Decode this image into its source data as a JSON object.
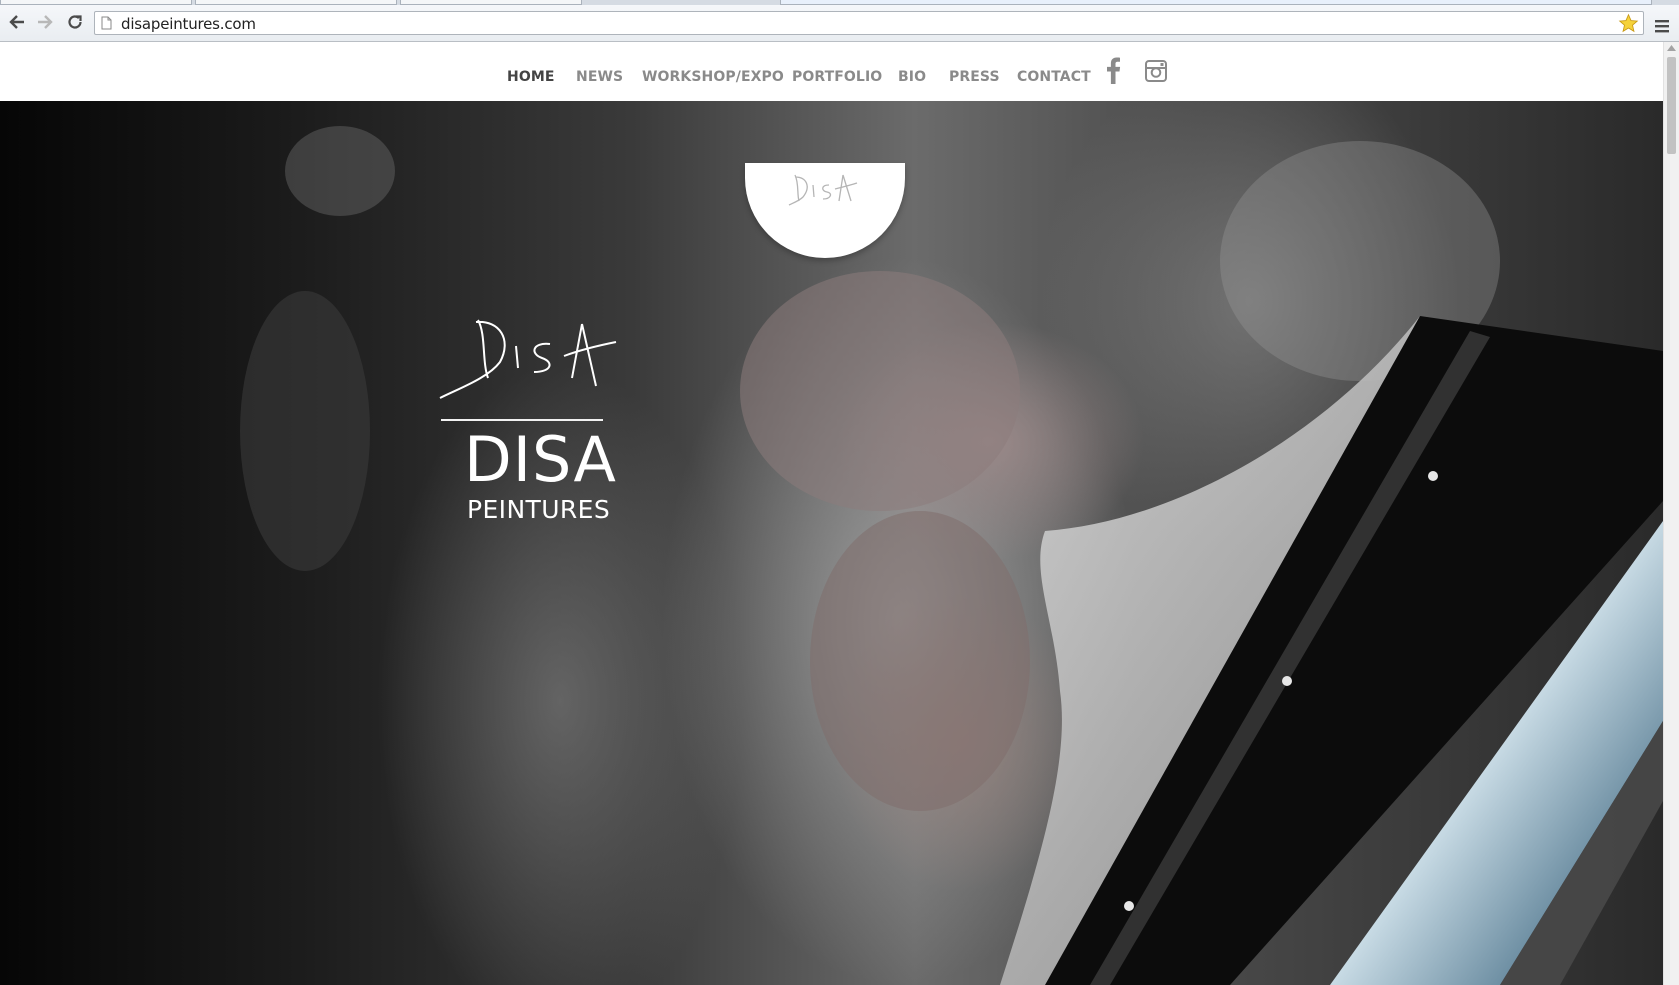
{
  "browser": {
    "url": "disapeintures.com",
    "icons": {
      "back": "back-arrow-icon",
      "forward": "forward-arrow-icon",
      "reload": "reload-icon",
      "bookmark": "star-icon",
      "menu": "hamburger-menu-icon"
    }
  },
  "nav": {
    "items": [
      {
        "label": "HOME",
        "active": true
      },
      {
        "label": "NEWS",
        "active": false
      },
      {
        "label": "WORKSHOP/EXPO",
        "active": false
      },
      {
        "label": "PORTFOLIO",
        "active": false
      },
      {
        "label": "BIO",
        "active": false
      },
      {
        "label": "PRESS",
        "active": false
      },
      {
        "label": "CONTACT",
        "active": false
      }
    ],
    "social": [
      "facebook-icon",
      "instagram-icon"
    ],
    "colors": {
      "inactive": "#8a8a8a",
      "active": "#444444"
    }
  },
  "hero": {
    "badge_signature": "Disa",
    "logo_signature": "Disa",
    "title": "DISA",
    "subtitle": "PEINTURES"
  }
}
